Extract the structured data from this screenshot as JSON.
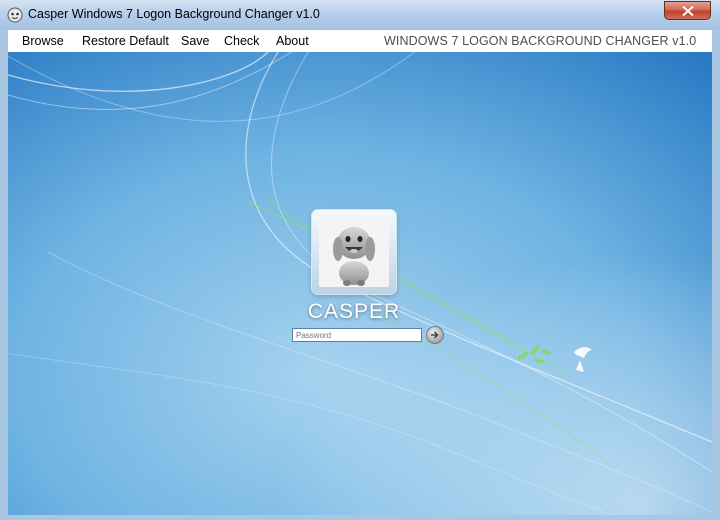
{
  "window": {
    "title": "Casper Windows 7 Logon Background Changer v1.0",
    "icon": "app-logo-icon",
    "close_icon": "close-icon"
  },
  "menu": {
    "items": [
      {
        "label": "Browse"
      },
      {
        "label": "Restore Default"
      },
      {
        "label": "Save"
      },
      {
        "label": "Check"
      },
      {
        "label": "About"
      }
    ],
    "heading": "WINDOWS 7 LOGON BACKGROUND CHANGER v1.0"
  },
  "logon_preview": {
    "user_name": "CASPER",
    "password_placeholder": "Password",
    "go_icon": "arrow-right-icon",
    "avatar_icon": "dog-avatar-icon"
  },
  "colors": {
    "title_bar": "#b7cfea",
    "close_button": "#c0412e",
    "background_blue": "#2f7fc7"
  }
}
